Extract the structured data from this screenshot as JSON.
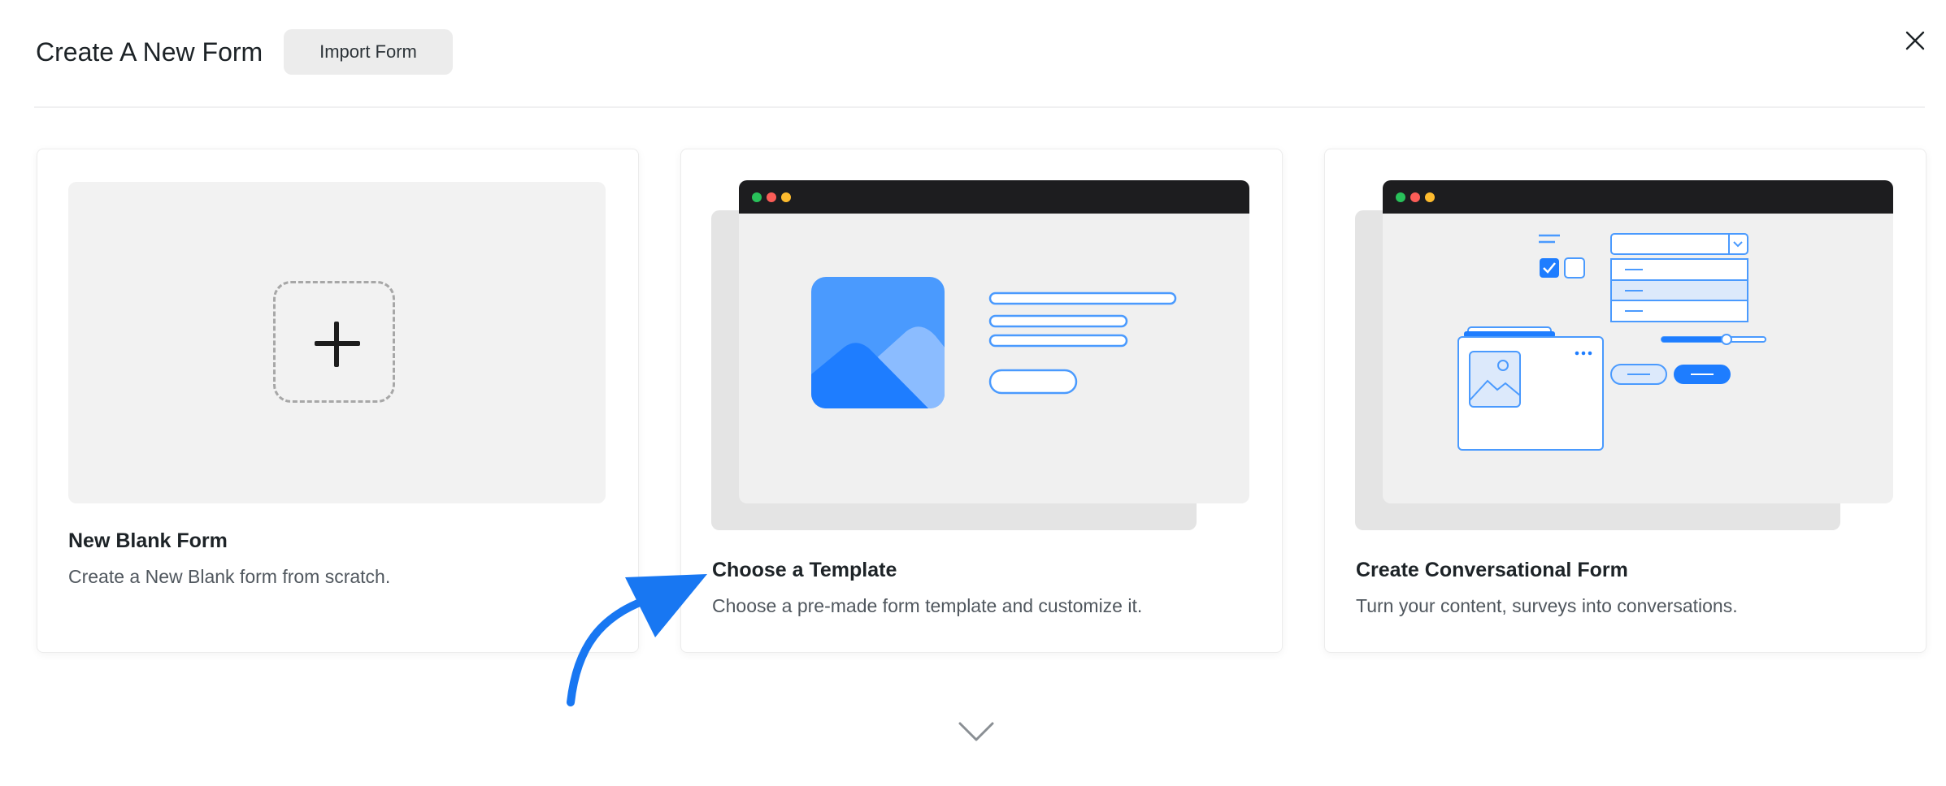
{
  "header": {
    "title": "Create A New Form",
    "import_label": "Import Form"
  },
  "cards": [
    {
      "title": "New Blank Form",
      "description": "Create a New Blank form from scratch."
    },
    {
      "title": "Choose a Template",
      "description": "Choose a pre-made form template and customize it."
    },
    {
      "title": "Create Conversational Form",
      "description": "Turn your content, surveys into conversations."
    }
  ],
  "icons": {
    "close": "close-icon",
    "plus": "plus-icon",
    "chevron": "chevron-down-icon",
    "arrow": "curved-arrow-icon"
  },
  "colors": {
    "accent": "#1877f2",
    "illustration_blue": "#4a9afe",
    "window_bar": "#1d1d1f",
    "card_preview_bg": "#f0f0f0"
  }
}
